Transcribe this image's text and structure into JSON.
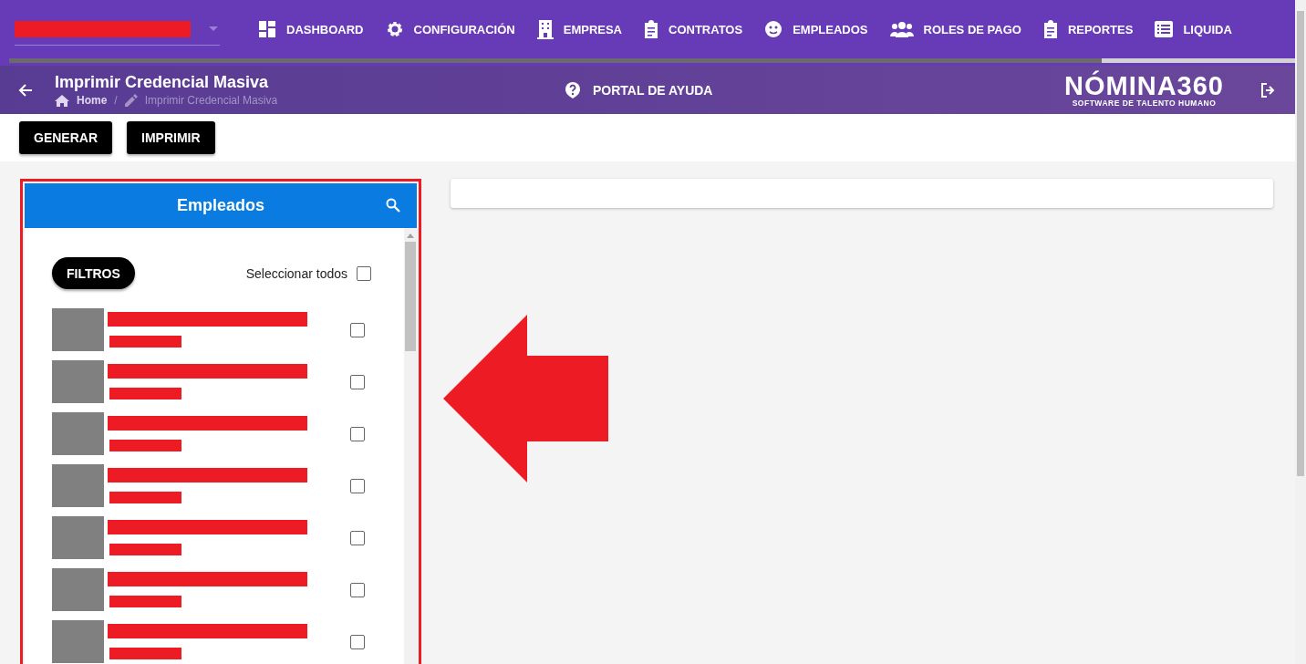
{
  "nav": {
    "items": [
      {
        "label": "DASHBOARD",
        "kind": "dashboard"
      },
      {
        "label": "CONFIGURACIÓN",
        "kind": "gear"
      },
      {
        "label": "EMPRESA",
        "kind": "building"
      },
      {
        "label": "CONTRATOS",
        "kind": "clipboard"
      },
      {
        "label": "EMPLEADOS",
        "kind": "face"
      },
      {
        "label": "ROLES DE PAGO",
        "kind": "people"
      },
      {
        "label": "REPORTES",
        "kind": "clipboard"
      },
      {
        "label": "LIQUIDA",
        "kind": "list"
      }
    ]
  },
  "header": {
    "title": "Imprimir Credencial Masiva",
    "breadcrumb": [
      "Home",
      "Imprimir Credencial Masiva"
    ],
    "breadcrumb_separator": "/",
    "help": "PORTAL DE AYUDA",
    "logo": {
      "name": "NÓMINA360",
      "tagline": "SOFTWARE DE TALENTO HUMANO"
    }
  },
  "toolbar": {
    "buttons": [
      "GENERAR",
      "IMPRIMIR"
    ]
  },
  "employees_panel": {
    "title": "Empleados",
    "filter_button": "FILTROS",
    "select_all": {
      "label": "Seleccionar todos",
      "checked": false
    },
    "employees": [
      {
        "checked": false
      },
      {
        "checked": false
      },
      {
        "checked": false
      },
      {
        "checked": false
      },
      {
        "checked": false
      },
      {
        "checked": false
      },
      {
        "checked": false
      }
    ]
  }
}
